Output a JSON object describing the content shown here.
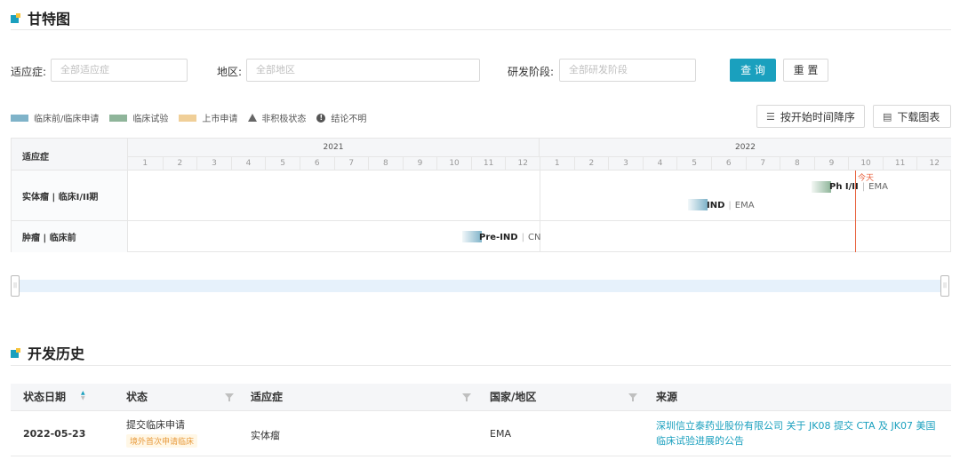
{
  "gantt_section": {
    "title": "甘特图"
  },
  "filters": {
    "indication_label": "适应症:",
    "indication_placeholder": "全部适应症",
    "region_label": "地区:",
    "region_placeholder": "全部地区",
    "stage_label": "研发阶段:",
    "stage_placeholder": "全部研发阶段",
    "query_button": "查 询",
    "reset_button": "重 置"
  },
  "legend": {
    "items": [
      {
        "label": "临床前/临床申请",
        "color": "#7fb3c9"
      },
      {
        "label": "临床试验",
        "color": "#8fb59a"
      },
      {
        "label": "上市申请",
        "color": "#f0cf98"
      },
      {
        "label": "非积极状态",
        "icon": "triangle-icon"
      },
      {
        "label": "结论不明",
        "icon": "info-circle-icon"
      }
    ]
  },
  "toolbar": {
    "sort_button": "按开始时间降序",
    "download_button": "下载图表"
  },
  "gantt": {
    "header_label": "适应症",
    "years": [
      "2021",
      "2022"
    ],
    "months": [
      "1",
      "2",
      "3",
      "4",
      "5",
      "6",
      "7",
      "8",
      "9",
      "10",
      "11",
      "12",
      "1",
      "2",
      "3",
      "4",
      "5",
      "6",
      "7",
      "8",
      "9",
      "10",
      "11",
      "12"
    ],
    "today_label": "今天",
    "rows": [
      {
        "label": "实体瘤 | 临床I/II期",
        "bars": [
          {
            "stage": "Ph I/II",
            "region": "EMA",
            "color": "#8fb59a"
          },
          {
            "stage": "IND",
            "region": "EMA",
            "color": "#7fb3c9"
          }
        ]
      },
      {
        "label": "肿瘤 | 临床前",
        "bars": [
          {
            "stage": "Pre-IND",
            "region": "CN",
            "color": "#7fb3c9"
          }
        ]
      }
    ]
  },
  "history_section": {
    "title": "开发历史"
  },
  "history_table": {
    "columns": [
      "状态日期",
      "状态",
      "适应症",
      "国家/地区",
      "来源"
    ],
    "rows": [
      {
        "date": "2022-05-23",
        "status": "提交临床申请",
        "status_tag": "境外首次申请临床",
        "indication": "实体瘤",
        "region": "EMA",
        "source": "深圳信立泰药业股份有限公司 关于 JK08 提交 CTA 及 JK07 美国临床试验进展的公告"
      }
    ]
  },
  "colors": {
    "accent": "#1aa0be",
    "today": "#e8603c"
  }
}
